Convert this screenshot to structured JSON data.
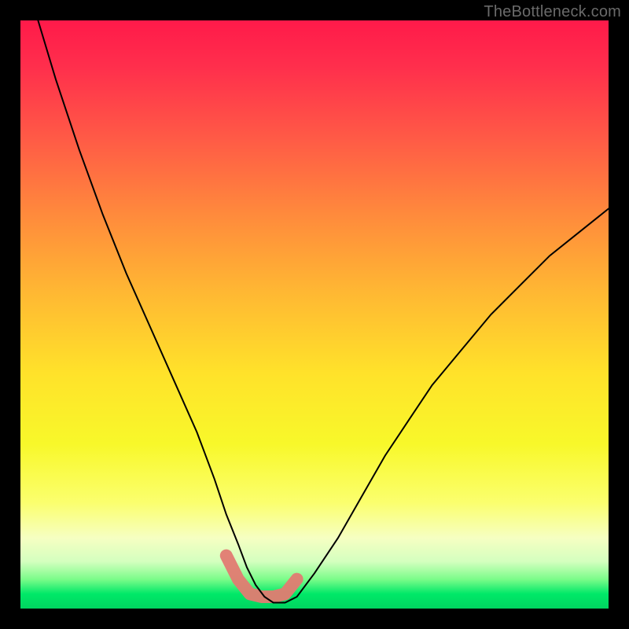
{
  "watermark": "TheBottleneck.com",
  "colors": {
    "frame": "#000000",
    "curve": "#000000",
    "highlight": "#e17b72"
  },
  "chart_data": {
    "type": "line",
    "title": "",
    "xlabel": "",
    "ylabel": "",
    "xlim": [
      0,
      100
    ],
    "ylim": [
      0,
      100
    ],
    "grid": false,
    "series": [
      {
        "name": "bottleneck-curve",
        "x": [
          3,
          6,
          10,
          14,
          18,
          22,
          26,
          30,
          33,
          35,
          37,
          38.5,
          40,
          41.5,
          43,
          45,
          47,
          50,
          54,
          58,
          62,
          66,
          70,
          75,
          80,
          85,
          90,
          95,
          100
        ],
        "y": [
          100,
          90,
          78,
          67,
          57,
          48,
          39,
          30,
          22,
          16,
          11,
          7,
          4,
          2,
          1,
          1,
          2,
          6,
          12,
          19,
          26,
          32,
          38,
          44,
          50,
          55,
          60,
          64,
          68
        ]
      },
      {
        "name": "highlighted-bottom",
        "x": [
          35,
          37,
          39,
          41,
          43,
          45,
          47
        ],
        "y": [
          9,
          5,
          2.5,
          2,
          2,
          2.5,
          5
        ]
      }
    ],
    "annotations": []
  }
}
